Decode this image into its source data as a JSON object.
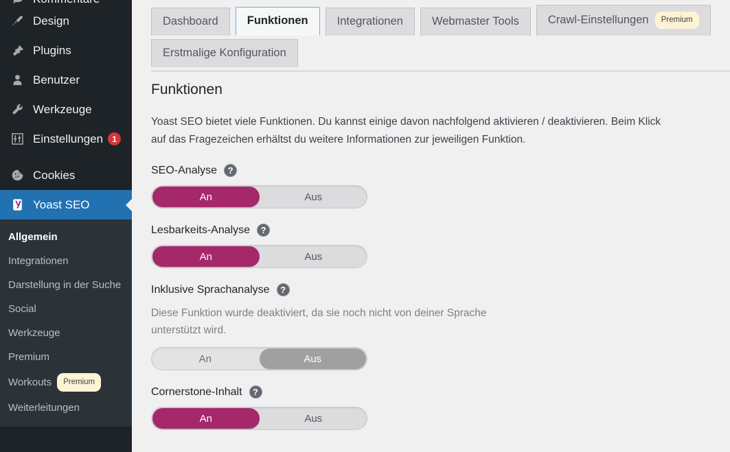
{
  "sidebar": {
    "menu": [
      {
        "label": "Kommentare",
        "icon": "comments-icon",
        "badge": null,
        "cut": true
      },
      {
        "label": "Design",
        "icon": "appearance-brush-icon",
        "badge": null
      },
      {
        "label": "Plugins",
        "icon": "plugins-plug-icon",
        "badge": null
      },
      {
        "label": "Benutzer",
        "icon": "users-person-icon",
        "badge": null
      },
      {
        "label": "Werkzeuge",
        "icon": "tools-wrench-icon",
        "badge": null
      },
      {
        "label": "Einstellungen",
        "icon": "settings-sliders-icon",
        "badge": "1"
      },
      {
        "label": "Cookies",
        "icon": "cookie-icon",
        "badge": null,
        "separated": true
      },
      {
        "label": "Yoast SEO",
        "icon": "yoast-logo-icon",
        "badge": null,
        "current": true
      }
    ],
    "submenu": [
      {
        "label": "Allgemein",
        "active": true
      },
      {
        "label": "Integrationen",
        "active": false
      },
      {
        "label": "Darstellung in der Suche",
        "active": false
      },
      {
        "label": "Social",
        "active": false
      },
      {
        "label": "Werkzeuge",
        "active": false
      },
      {
        "label": "Premium",
        "active": false
      },
      {
        "label": "Workouts",
        "active": false,
        "badge": "Premium"
      },
      {
        "label": "Weiterleitungen",
        "active": false
      }
    ]
  },
  "tabs": {
    "row1": [
      {
        "label": "Dashboard",
        "active": false,
        "badge": null
      },
      {
        "label": "Funktionen",
        "active": true,
        "badge": null
      },
      {
        "label": "Integrationen",
        "active": false,
        "badge": null
      },
      {
        "label": "Webmaster Tools",
        "active": false,
        "badge": null
      },
      {
        "label": "Crawl-Einstellungen",
        "active": false,
        "badge": "Premium"
      }
    ],
    "row2": [
      {
        "label": "Erstmalige Konfiguration",
        "active": false,
        "badge": null
      }
    ]
  },
  "page": {
    "title": "Funktionen",
    "intro": "Yoast SEO bietet viele Funktionen. Du kannst einige davon nachfolgend aktivieren / deaktivieren. Beim Klick auf das Fragezeichen erhältst du weitere Informationen zur jeweiligen Funktion.",
    "help_glyph": "?"
  },
  "features": [
    {
      "title": "SEO-Analyse",
      "note": null,
      "on_label": "An",
      "off_label": "Aus",
      "state": "on",
      "disabled": false
    },
    {
      "title": "Lesbarkeits-Analyse",
      "note": null,
      "on_label": "An",
      "off_label": "Aus",
      "state": "on",
      "disabled": false
    },
    {
      "title": "Inklusive Sprachanalyse",
      "note": "Diese Funktion wurde deaktiviert, da sie noch nicht von deiner Sprache unterstützt wird.",
      "on_label": "An",
      "off_label": "Aus",
      "state": "off",
      "disabled": true
    },
    {
      "title": "Cornerstone-Inhalt",
      "note": null,
      "on_label": "An",
      "off_label": "Aus",
      "state": "on",
      "disabled": false
    }
  ],
  "colors": {
    "yoast_magenta": "#a4286a",
    "wp_blue": "#2271b1",
    "sidebar_bg": "#1d2327",
    "submenu_bg": "#2c3338",
    "content_bg": "#f0f0f1",
    "badge_red": "#d63638",
    "premium_cream": "#fdf4d5"
  }
}
